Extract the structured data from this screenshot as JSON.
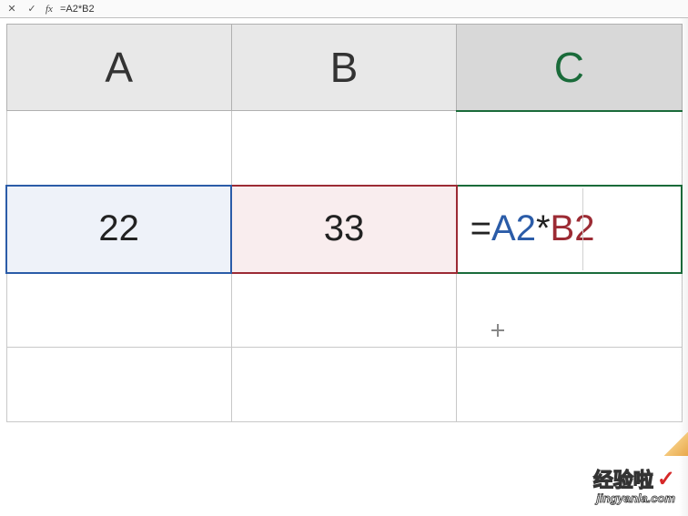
{
  "formula_bar": {
    "cancel_icon": "✕",
    "confirm_icon": "✓",
    "fx_label": "fx",
    "formula_text": "=A2*B2"
  },
  "columns": {
    "a": "A",
    "b": "B",
    "c": "C"
  },
  "cells": {
    "a2": "22",
    "b2": "33",
    "c2_eq": "=",
    "c2_ref1": "A2",
    "c2_op": "*",
    "c2_ref2": "B2"
  },
  "watermark": {
    "main": "经验啦",
    "check": "✓",
    "sub": "jingyanla.com"
  }
}
